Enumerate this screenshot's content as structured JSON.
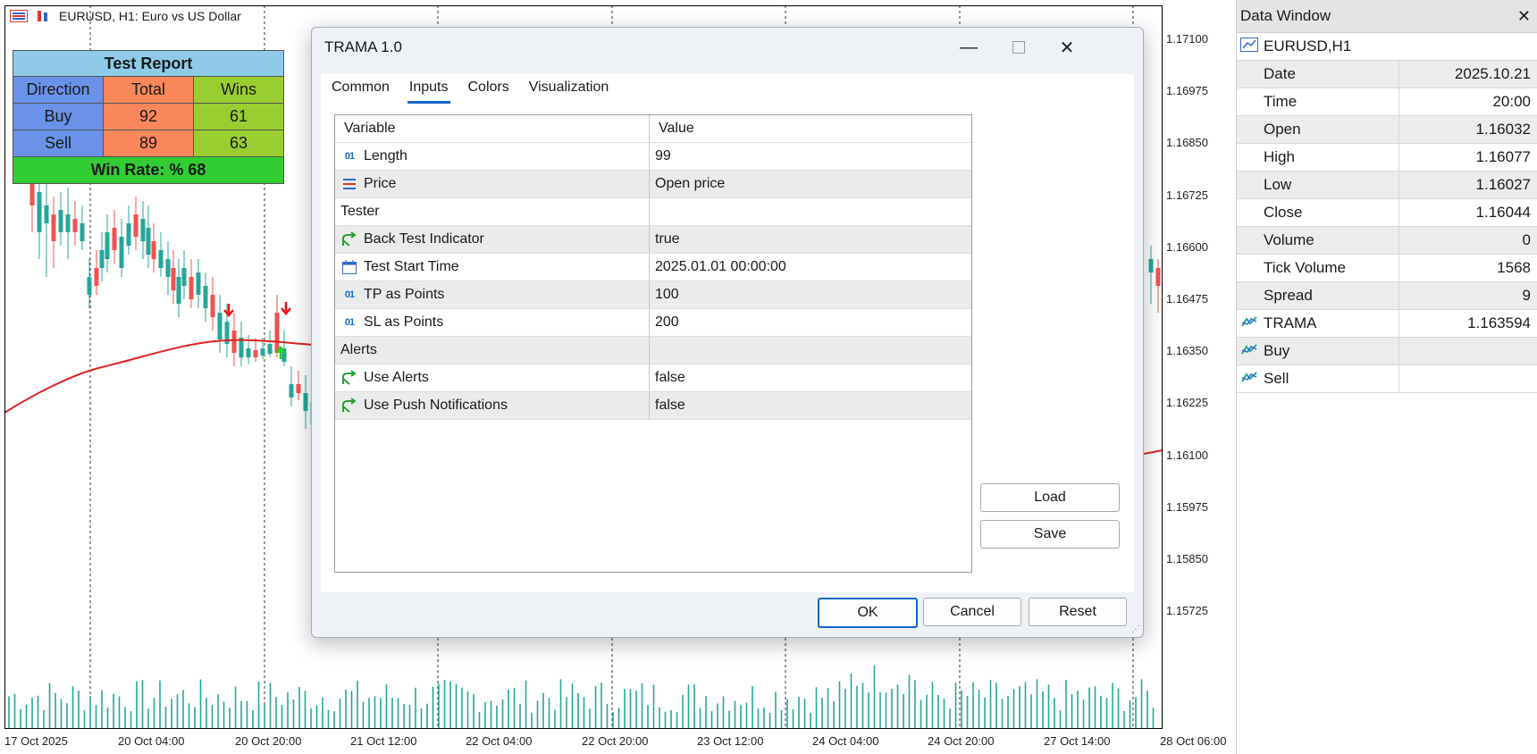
{
  "chart": {
    "symbol_title": "EURUSD, H1:  Euro vs US Dollar",
    "price_labels": [
      "1.17100",
      "1.16975",
      "1.16850",
      "1.16725",
      "1.16600",
      "1.16475",
      "1.16350",
      "1.16225",
      "1.16100",
      "1.15975",
      "1.15850",
      "1.15725"
    ],
    "time_labels": [
      "17 Oct 2025",
      "20 Oct 04:00",
      "20 Oct 20:00",
      "21 Oct 12:00",
      "22 Oct 04:00",
      "22 Oct 20:00",
      "23 Oct 12:00",
      "24 Oct 04:00",
      "24 Oct 20:00",
      "27 Oct 14:00",
      "28 Oct 06:00"
    ],
    "colors": {
      "up": "#26a69a",
      "down": "#ef5350",
      "ma": "#e02020",
      "volume": "#26a69a",
      "buy_arrow": "#22cc22",
      "sell_arrow": "#ee1111"
    }
  },
  "report": {
    "title": "Test Report",
    "headers": [
      "Direction",
      "Total",
      "Wins"
    ],
    "rows": [
      {
        "direction": "Buy",
        "total": "92",
        "wins": "61"
      },
      {
        "direction": "Sell",
        "total": "89",
        "wins": "63"
      }
    ],
    "win_rate": "Win Rate: %  68"
  },
  "dialog": {
    "title": "TRAMA 1.0",
    "tabs": [
      "Common",
      "Inputs",
      "Colors",
      "Visualization"
    ],
    "active_tab": "Inputs",
    "grid_headers": {
      "variable": "Variable",
      "value": "Value"
    },
    "rows": [
      {
        "icon": "numeric-icon",
        "name": "Length",
        "value": "99"
      },
      {
        "icon": "list-icon",
        "name": "Price",
        "value": "Open price"
      },
      {
        "icon": "",
        "name": "Tester",
        "value": ""
      },
      {
        "icon": "bool-icon",
        "name": "Back Test Indicator",
        "value": "true"
      },
      {
        "icon": "calendar-icon",
        "name": "Test Start Time",
        "value": "2025.01.01 00:00:00"
      },
      {
        "icon": "numeric-icon",
        "name": "TP as Points",
        "value": "100"
      },
      {
        "icon": "numeric-icon",
        "name": "SL as Points",
        "value": "200"
      },
      {
        "icon": "",
        "name": "Alerts",
        "value": ""
      },
      {
        "icon": "bool-icon",
        "name": "Use Alerts",
        "value": "false"
      },
      {
        "icon": "bool-icon",
        "name": "Use Push Notifications",
        "value": "false"
      }
    ],
    "buttons": {
      "load": "Load",
      "save": "Save",
      "ok": "OK",
      "cancel": "Cancel",
      "reset": "Reset"
    }
  },
  "data_window": {
    "title": "Data Window",
    "symbol": "EURUSD,H1",
    "rows": [
      {
        "key": "Date",
        "value": "2025.10.21"
      },
      {
        "key": "Time",
        "value": "20:00"
      },
      {
        "key": "Open",
        "value": "1.16032"
      },
      {
        "key": "High",
        "value": "1.16077"
      },
      {
        "key": "Low",
        "value": "1.16027"
      },
      {
        "key": "Close",
        "value": "1.16044"
      },
      {
        "key": "Volume",
        "value": "0"
      },
      {
        "key": "Tick Volume",
        "value": "1568"
      },
      {
        "key": "Spread",
        "value": "9"
      }
    ],
    "indicators": [
      {
        "key": "TRAMA",
        "value": "1.163594"
      },
      {
        "key": "Buy",
        "value": ""
      },
      {
        "key": "Sell",
        "value": ""
      }
    ]
  }
}
